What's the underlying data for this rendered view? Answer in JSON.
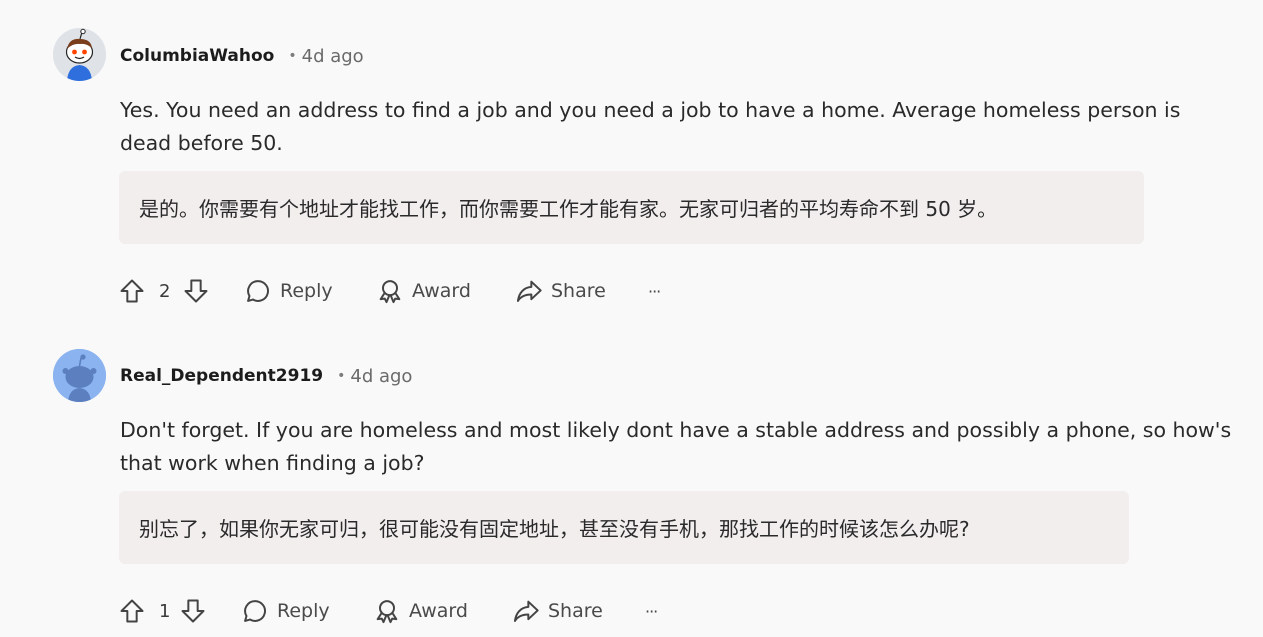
{
  "comments": [
    {
      "username": "ColumbiaWahoo",
      "dot": "•",
      "time": "4d ago",
      "body": "Yes. You need an address to find a job and you need a job to have a home. Average homeless person is dead before 50.",
      "translation": "是的。你需要有个地址才能找工作，而你需要工作才能有家。无家可归者的平均寿命不到 50 岁。",
      "votes": "2",
      "reply_label": "Reply",
      "award_label": "Award",
      "share_label": "Share",
      "more_label": "···",
      "avatar_color": "#dfe3e8"
    },
    {
      "username": "Real_Dependent2919",
      "dot": "•",
      "time": "4d ago",
      "body": "Don't forget. If you are homeless and most likely dont have a stable address and possibly a phone, so how's that work when finding a job?",
      "translation": "别忘了，如果你无家可归，很可能没有固定地址，甚至没有手机，那找工作的时候该怎么办呢?",
      "votes": "1",
      "reply_label": "Reply",
      "award_label": "Award",
      "share_label": "Share",
      "more_label": "···",
      "avatar_color": "#8ab3f0"
    }
  ]
}
